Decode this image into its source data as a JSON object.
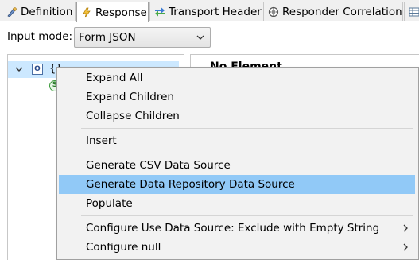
{
  "tabs": [
    {
      "label": "Definition",
      "icon": "definition-icon",
      "active": false
    },
    {
      "label": "Response",
      "icon": "response-icon",
      "active": true
    },
    {
      "label": "Transport Header",
      "icon": "transport-header-icon",
      "active": false
    },
    {
      "label": "Responder Correlation",
      "icon": "responder-correlation-icon",
      "active": false
    },
    {
      "label": "",
      "icon": "table-icon",
      "active": false
    }
  ],
  "input_mode": {
    "label": "Input mode:",
    "value": "Form JSON"
  },
  "tree": {
    "root_label": "{}",
    "root_icon_text": "O",
    "child_icon_text": "S"
  },
  "right_panel": {
    "heading": "No Element"
  },
  "context_menu": {
    "items": [
      {
        "label": "Expand All"
      },
      {
        "label": "Expand Children"
      },
      {
        "label": "Collapse Children"
      },
      {
        "label": "Insert"
      },
      {
        "label": "Generate CSV Data Source"
      },
      {
        "label": "Generate Data Repository Data Source",
        "highlighted": true
      },
      {
        "label": "Populate"
      },
      {
        "label": "Configure Use Data Source: Exclude with Empty String",
        "submenu": true
      },
      {
        "label": "Configure null",
        "submenu": true
      }
    ]
  },
  "colors": {
    "selection": "#cce8ff",
    "menu_highlight": "#91c9f7"
  }
}
